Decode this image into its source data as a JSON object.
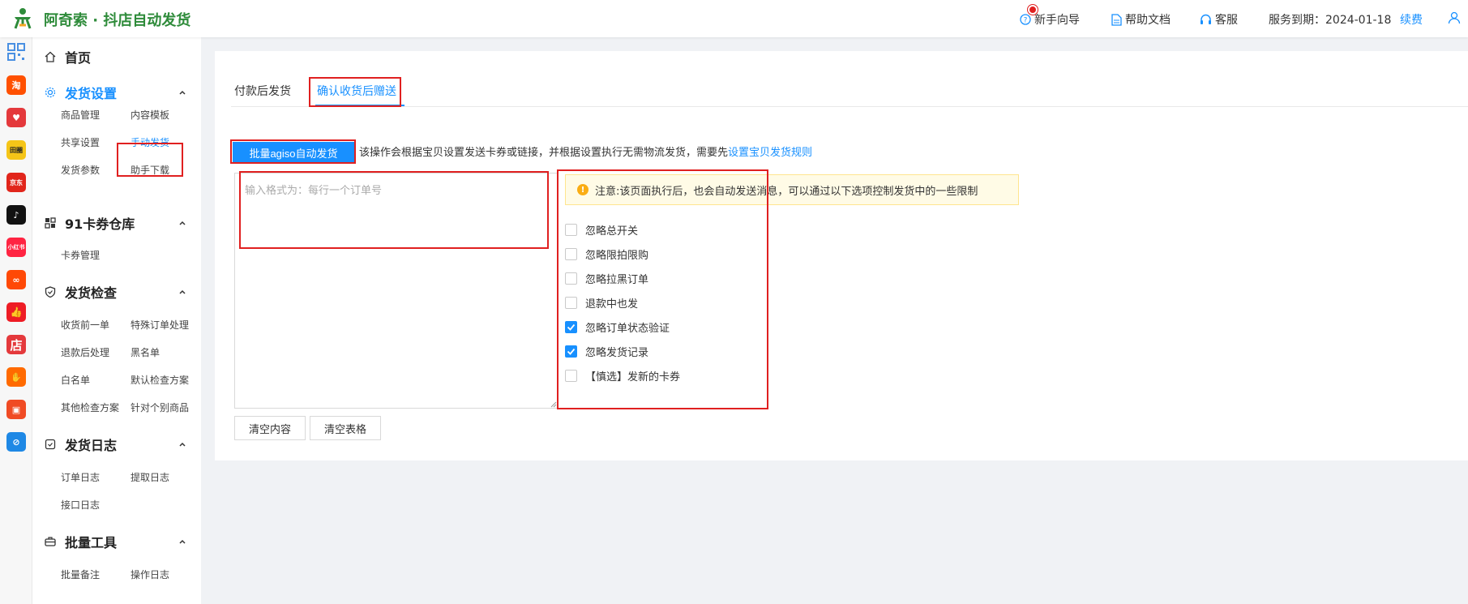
{
  "header": {
    "brand": "阿奇索 · 抖店自动发货",
    "guide": "新手向导",
    "help": "帮助文档",
    "service": "客服",
    "expiry": "服务到期：2024-01-18",
    "renew": "续费"
  },
  "app_strip": [
    {
      "name": "qr-app-icon",
      "label": "",
      "color": "#4a90e2"
    },
    {
      "name": "taobao-app-icon",
      "label": "淘",
      "color": "#ff5000"
    },
    {
      "name": "heart-app-icon",
      "label": "♥",
      "color": "#e4393c"
    },
    {
      "name": "shop-app-icon",
      "label": "田圈",
      "color": "#f5c518"
    },
    {
      "name": "jd-app-icon",
      "label": "京东",
      "color": "#e1251b"
    },
    {
      "name": "douyin-app-icon",
      "label": "♪",
      "color": "#111111"
    },
    {
      "name": "xiaohongshu-app-icon",
      "label": "小红书",
      "color": "#ff2442"
    },
    {
      "name": "kuaishou-app-icon",
      "label": "∞",
      "color": "#ff4906"
    },
    {
      "name": "thumb-app-icon",
      "label": "👍",
      "color": "#ee1c25"
    },
    {
      "name": "store-app-icon",
      "label": "店",
      "color": "#e4393c"
    },
    {
      "name": "bag-app-icon",
      "label": "✋",
      "color": "#ff6a00"
    },
    {
      "name": "basket-app-icon",
      "label": "▣",
      "color": "#f04b24"
    },
    {
      "name": "link-app-icon",
      "label": "⊘",
      "color": "#1e88e5"
    }
  ],
  "sidebar": {
    "home": "首页",
    "groups": [
      {
        "title": "发货设置",
        "items": [
          "商品管理",
          "内容模板",
          "共享设置",
          "手动发货",
          "发货参数",
          "助手下载"
        ]
      },
      {
        "title": "91卡券仓库",
        "items": [
          "卡券管理"
        ]
      },
      {
        "title": "发货检查",
        "items": [
          "收货前一单",
          "特殊订单处理",
          "退款后处理",
          "黑名单",
          "白名单",
          "默认检查方案",
          "其他检查方案",
          "针对个别商品"
        ]
      },
      {
        "title": "发货日志",
        "items": [
          "订单日志",
          "提取日志",
          "接口日志"
        ]
      },
      {
        "title": "批量工具",
        "items": [
          "批量备注",
          "操作日志"
        ]
      }
    ]
  },
  "main": {
    "tabs": [
      "付款后发货",
      "确认收货后赠送"
    ],
    "batch_button": "批量agiso自动发货",
    "description": "该操作会根据宝贝设置发送卡券或链接，并根据设置执行无需物流发货，需要先",
    "description_link": "设置宝贝发货规则",
    "textarea_placeholder": "输入格式为：每行一个订单号",
    "notice": "注意:该页面执行后，也会自动发送消息，可以通过以下选项控制发货中的一些限制",
    "options": [
      {
        "label": "忽略总开关",
        "checked": false
      },
      {
        "label": "忽略限拍限购",
        "checked": false
      },
      {
        "label": "忽略拉黑订单",
        "checked": false
      },
      {
        "label": "退款中也发",
        "checked": false
      },
      {
        "label": "忽略订单状态验证",
        "checked": true
      },
      {
        "label": "忽略发货记录",
        "checked": true
      },
      {
        "label": "【慎选】发新的卡券",
        "checked": false
      }
    ],
    "clear_content": "清空内容",
    "clear_table": "清空表格"
  },
  "colors": {
    "accent": "#1890ff",
    "brand": "#2e8b3a",
    "annotation": "#e02020",
    "notice_bg": "#fffbe6"
  }
}
